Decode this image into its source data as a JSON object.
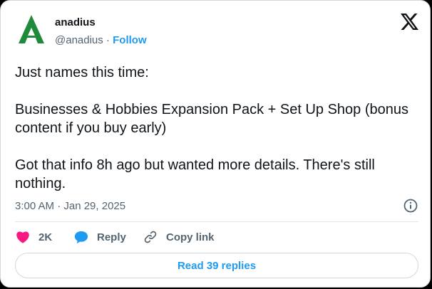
{
  "author": {
    "name": "anadius",
    "handle": "@anadius",
    "separator": " · ",
    "follow_label": "Follow"
  },
  "tweet": {
    "text": "Just names this time:\n\nBusinesses & Hobbies Expansion Pack + Set Up Shop (bonus content if you buy early)\n\nGot that info 8h ago but wanted more details. There's still nothing.",
    "timestamp": "3:00 AM · Jan 29, 2025"
  },
  "actions": {
    "like_count": "2K",
    "reply_label": "Reply",
    "copy_label": "Copy link"
  },
  "footer": {
    "read_replies_label": "Read 39 replies"
  },
  "icons": {
    "avatar": "green-letter-a-logo",
    "platform": "x-logo-icon",
    "info": "info-icon",
    "like": "heart-icon",
    "reply": "speech-bubble-icon",
    "copy": "link-icon"
  },
  "colors": {
    "accent": "#1d9bf0",
    "like": "#f91880",
    "avatar_green": "#1f8a3a",
    "secondary_text": "#536471"
  }
}
